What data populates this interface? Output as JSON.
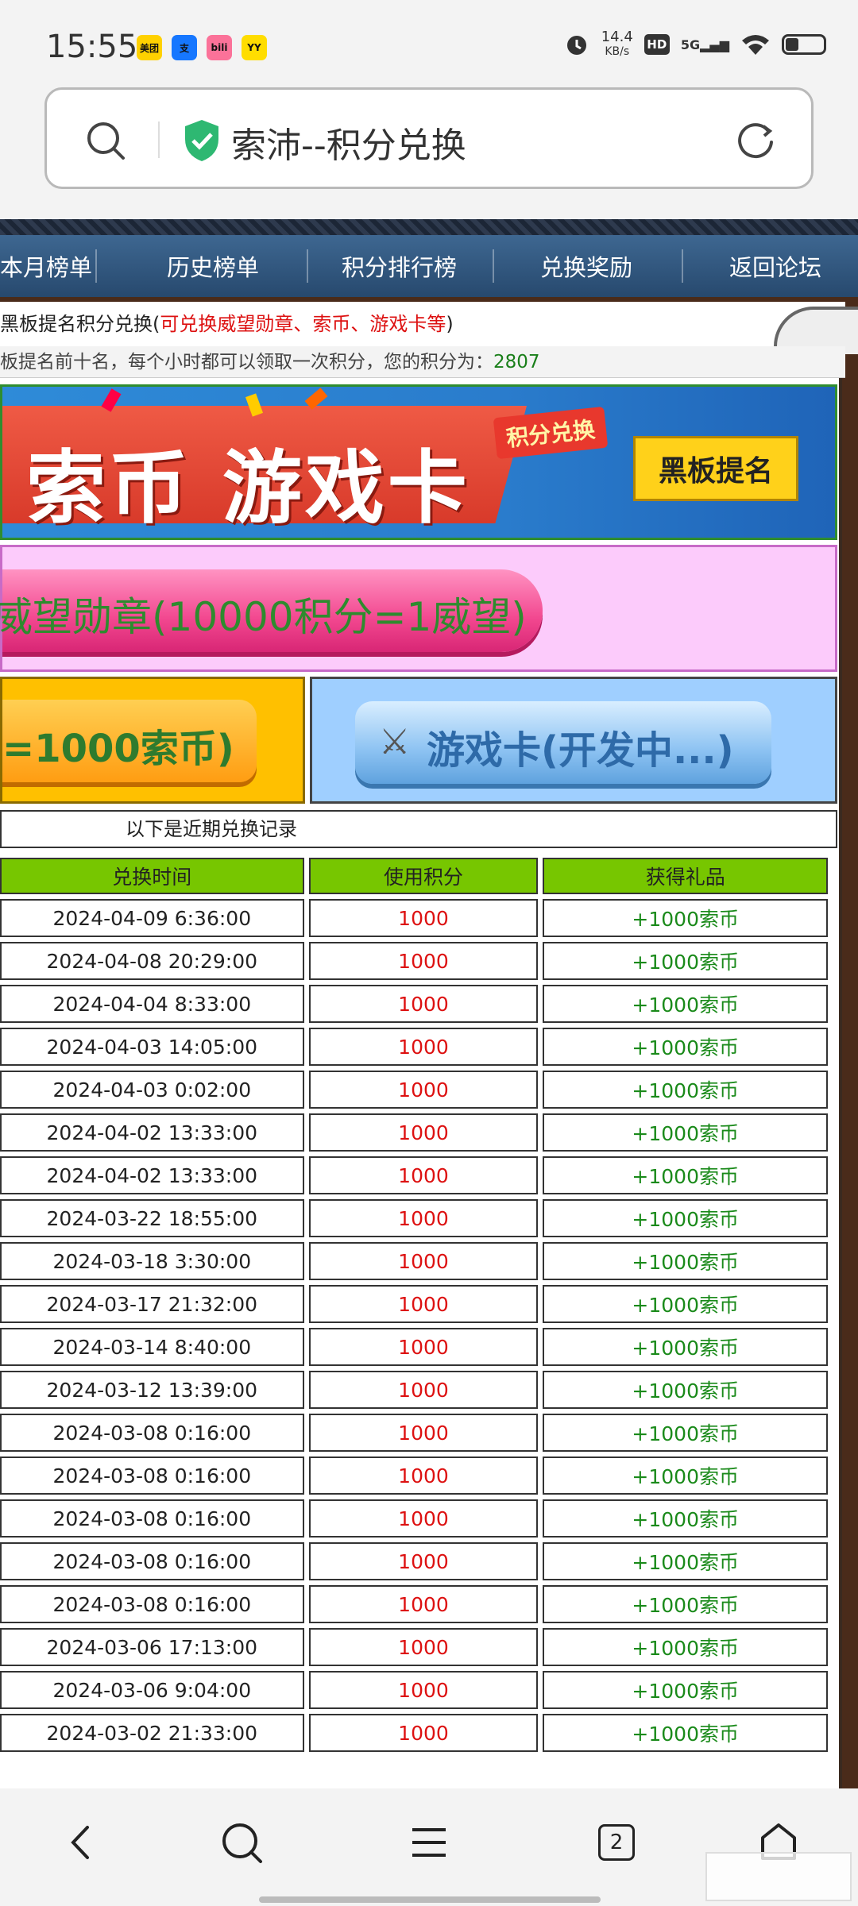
{
  "status_bar": {
    "time": "15:55",
    "apps": [
      {
        "name": "meituan-icon",
        "label": "美团",
        "color": "#ffd100"
      },
      {
        "name": "alipay-icon",
        "label": "支",
        "color": "#1677ff"
      },
      {
        "name": "bilibili-icon",
        "label": "bili",
        "color": "#fb7299"
      },
      {
        "name": "yy-icon",
        "label": "YY",
        "color": "#ffdd00"
      }
    ],
    "speed_value": "14.4",
    "speed_unit": "KB/s",
    "hd": "HD",
    "network": "5G"
  },
  "url_bar": {
    "title": "索沛--积分兑换"
  },
  "nav": {
    "items": [
      "本月榜单",
      "历史榜单",
      "积分排行榜",
      "兑换奖励",
      "返回论坛"
    ]
  },
  "notice": {
    "prefix": "黑板提名积分兑换(",
    "highlight": "可兑换威望勋章、索币、游戏卡等",
    "suffix": ")"
  },
  "info": {
    "text": "板提名前十名，每个小时都可以领取一次积分，您的积分为：",
    "points": "2807"
  },
  "banner": {
    "big_text": "索币 游戏卡",
    "tag": "积分兑换",
    "badge": "黑板提名"
  },
  "buttons": {
    "prestige": "威望勋章(10000积分=1威望)",
    "coin": "=1000索币)",
    "game_card": "游戏卡(开发中...)"
  },
  "records": {
    "caption": "以下是近期兑换记录",
    "headers": [
      "兑换时间",
      "使用积分",
      "获得礼品"
    ],
    "rows": [
      [
        "2024-04-09 6:36:00",
        "1000",
        "+1000索币"
      ],
      [
        "2024-04-08 20:29:00",
        "1000",
        "+1000索币"
      ],
      [
        "2024-04-04 8:33:00",
        "1000",
        "+1000索币"
      ],
      [
        "2024-04-03 14:05:00",
        "1000",
        "+1000索币"
      ],
      [
        "2024-04-03 0:02:00",
        "1000",
        "+1000索币"
      ],
      [
        "2024-04-02 13:33:00",
        "1000",
        "+1000索币"
      ],
      [
        "2024-04-02 13:33:00",
        "1000",
        "+1000索币"
      ],
      [
        "2024-03-22 18:55:00",
        "1000",
        "+1000索币"
      ],
      [
        "2024-03-18 3:30:00",
        "1000",
        "+1000索币"
      ],
      [
        "2024-03-17 21:32:00",
        "1000",
        "+1000索币"
      ],
      [
        "2024-03-14 8:40:00",
        "1000",
        "+1000索币"
      ],
      [
        "2024-03-12 13:39:00",
        "1000",
        "+1000索币"
      ],
      [
        "2024-03-08 0:16:00",
        "1000",
        "+1000索币"
      ],
      [
        "2024-03-08 0:16:00",
        "1000",
        "+1000索币"
      ],
      [
        "2024-03-08 0:16:00",
        "1000",
        "+1000索币"
      ],
      [
        "2024-03-08 0:16:00",
        "1000",
        "+1000索币"
      ],
      [
        "2024-03-08 0:16:00",
        "1000",
        "+1000索币"
      ],
      [
        "2024-03-06 17:13:00",
        "1000",
        "+1000索币"
      ],
      [
        "2024-03-06 9:04:00",
        "1000",
        "+1000索币"
      ],
      [
        "2024-03-02 21:33:00",
        "1000",
        "+1000索币"
      ]
    ]
  },
  "bottom_bar": {
    "tab_count": "2"
  }
}
